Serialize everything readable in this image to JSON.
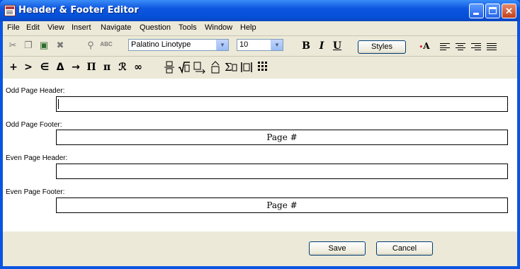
{
  "window": {
    "title": "Header & Footer Editor"
  },
  "menu": [
    "File",
    "Edit",
    "View",
    "Insert",
    "Navigate",
    "Question",
    "Tools",
    "Window",
    "Help"
  ],
  "toolbar": {
    "font_family": "Palatino Linotype",
    "font_size": "10",
    "bold": "B",
    "italic": "I",
    "underline": "U",
    "styles_label": "Styles"
  },
  "math_symbols": [
    "+",
    ">",
    "∈",
    "Δ",
    "→",
    "Π",
    "π",
    "ℛ",
    "∞"
  ],
  "fields": {
    "odd_header": {
      "label": "Odd Page Header:",
      "value": ""
    },
    "odd_footer": {
      "label": "Odd Page Footer:",
      "value": "Page #"
    },
    "even_header": {
      "label": "Even Page Header:",
      "value": ""
    },
    "even_footer": {
      "label": "Even Page Footer:",
      "value": "Page #"
    }
  },
  "buttons": {
    "save": "Save",
    "cancel": "Cancel"
  }
}
